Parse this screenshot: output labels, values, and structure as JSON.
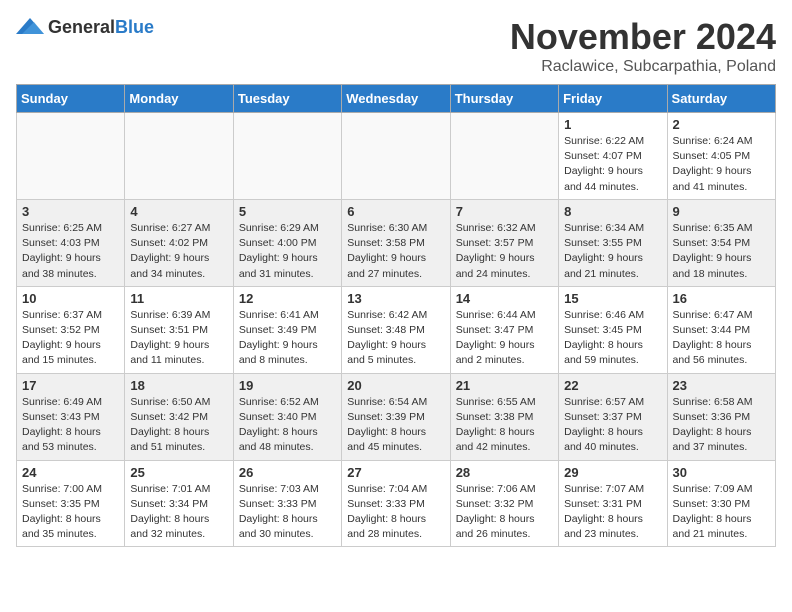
{
  "logo": {
    "general": "General",
    "blue": "Blue"
  },
  "title": "November 2024",
  "location": "Raclawice, Subcarpathia, Poland",
  "headers": [
    "Sunday",
    "Monday",
    "Tuesday",
    "Wednesday",
    "Thursday",
    "Friday",
    "Saturday"
  ],
  "weeks": [
    [
      {
        "day": "",
        "info": "",
        "empty": true
      },
      {
        "day": "",
        "info": "",
        "empty": true
      },
      {
        "day": "",
        "info": "",
        "empty": true
      },
      {
        "day": "",
        "info": "",
        "empty": true
      },
      {
        "day": "",
        "info": "",
        "empty": true
      },
      {
        "day": "1",
        "info": "Sunrise: 6:22 AM\nSunset: 4:07 PM\nDaylight: 9 hours and 44 minutes."
      },
      {
        "day": "2",
        "info": "Sunrise: 6:24 AM\nSunset: 4:05 PM\nDaylight: 9 hours and 41 minutes."
      }
    ],
    [
      {
        "day": "3",
        "info": "Sunrise: 6:25 AM\nSunset: 4:03 PM\nDaylight: 9 hours and 38 minutes."
      },
      {
        "day": "4",
        "info": "Sunrise: 6:27 AM\nSunset: 4:02 PM\nDaylight: 9 hours and 34 minutes."
      },
      {
        "day": "5",
        "info": "Sunrise: 6:29 AM\nSunset: 4:00 PM\nDaylight: 9 hours and 31 minutes."
      },
      {
        "day": "6",
        "info": "Sunrise: 6:30 AM\nSunset: 3:58 PM\nDaylight: 9 hours and 27 minutes."
      },
      {
        "day": "7",
        "info": "Sunrise: 6:32 AM\nSunset: 3:57 PM\nDaylight: 9 hours and 24 minutes."
      },
      {
        "day": "8",
        "info": "Sunrise: 6:34 AM\nSunset: 3:55 PM\nDaylight: 9 hours and 21 minutes."
      },
      {
        "day": "9",
        "info": "Sunrise: 6:35 AM\nSunset: 3:54 PM\nDaylight: 9 hours and 18 minutes."
      }
    ],
    [
      {
        "day": "10",
        "info": "Sunrise: 6:37 AM\nSunset: 3:52 PM\nDaylight: 9 hours and 15 minutes."
      },
      {
        "day": "11",
        "info": "Sunrise: 6:39 AM\nSunset: 3:51 PM\nDaylight: 9 hours and 11 minutes."
      },
      {
        "day": "12",
        "info": "Sunrise: 6:41 AM\nSunset: 3:49 PM\nDaylight: 9 hours and 8 minutes."
      },
      {
        "day": "13",
        "info": "Sunrise: 6:42 AM\nSunset: 3:48 PM\nDaylight: 9 hours and 5 minutes."
      },
      {
        "day": "14",
        "info": "Sunrise: 6:44 AM\nSunset: 3:47 PM\nDaylight: 9 hours and 2 minutes."
      },
      {
        "day": "15",
        "info": "Sunrise: 6:46 AM\nSunset: 3:45 PM\nDaylight: 8 hours and 59 minutes."
      },
      {
        "day": "16",
        "info": "Sunrise: 6:47 AM\nSunset: 3:44 PM\nDaylight: 8 hours and 56 minutes."
      }
    ],
    [
      {
        "day": "17",
        "info": "Sunrise: 6:49 AM\nSunset: 3:43 PM\nDaylight: 8 hours and 53 minutes."
      },
      {
        "day": "18",
        "info": "Sunrise: 6:50 AM\nSunset: 3:42 PM\nDaylight: 8 hours and 51 minutes."
      },
      {
        "day": "19",
        "info": "Sunrise: 6:52 AM\nSunset: 3:40 PM\nDaylight: 8 hours and 48 minutes."
      },
      {
        "day": "20",
        "info": "Sunrise: 6:54 AM\nSunset: 3:39 PM\nDaylight: 8 hours and 45 minutes."
      },
      {
        "day": "21",
        "info": "Sunrise: 6:55 AM\nSunset: 3:38 PM\nDaylight: 8 hours and 42 minutes."
      },
      {
        "day": "22",
        "info": "Sunrise: 6:57 AM\nSunset: 3:37 PM\nDaylight: 8 hours and 40 minutes."
      },
      {
        "day": "23",
        "info": "Sunrise: 6:58 AM\nSunset: 3:36 PM\nDaylight: 8 hours and 37 minutes."
      }
    ],
    [
      {
        "day": "24",
        "info": "Sunrise: 7:00 AM\nSunset: 3:35 PM\nDaylight: 8 hours and 35 minutes."
      },
      {
        "day": "25",
        "info": "Sunrise: 7:01 AM\nSunset: 3:34 PM\nDaylight: 8 hours and 32 minutes."
      },
      {
        "day": "26",
        "info": "Sunrise: 7:03 AM\nSunset: 3:33 PM\nDaylight: 8 hours and 30 minutes."
      },
      {
        "day": "27",
        "info": "Sunrise: 7:04 AM\nSunset: 3:33 PM\nDaylight: 8 hours and 28 minutes."
      },
      {
        "day": "28",
        "info": "Sunrise: 7:06 AM\nSunset: 3:32 PM\nDaylight: 8 hours and 26 minutes."
      },
      {
        "day": "29",
        "info": "Sunrise: 7:07 AM\nSunset: 3:31 PM\nDaylight: 8 hours and 23 minutes."
      },
      {
        "day": "30",
        "info": "Sunrise: 7:09 AM\nSunset: 3:30 PM\nDaylight: 8 hours and 21 minutes."
      }
    ]
  ]
}
